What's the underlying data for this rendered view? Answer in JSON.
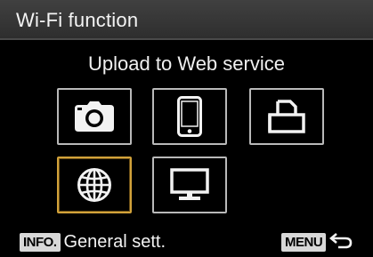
{
  "header": {
    "title": "Wi-Fi function"
  },
  "content": {
    "heading": "Upload to Web service"
  },
  "options": [
    {
      "icon": "camera-icon"
    },
    {
      "icon": "smartphone-icon"
    },
    {
      "icon": "printer-icon"
    },
    {
      "icon": "globe-icon",
      "selected": true
    },
    {
      "icon": "monitor-icon"
    }
  ],
  "footer": {
    "info_badge": "INFO.",
    "info_label": "General sett.",
    "menu_badge": "MENU",
    "back_icon": "return-arrow-icon"
  },
  "colors": {
    "selection": "#d2a23a",
    "tile_border": "#b9b9b9",
    "title_bar": "#3a3a3a"
  }
}
